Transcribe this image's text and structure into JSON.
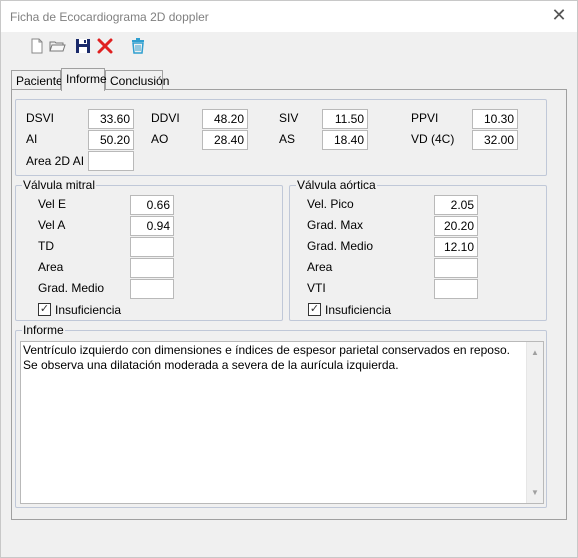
{
  "window": {
    "title": "Ficha de Ecocardiograma 2D doppler"
  },
  "toolbar": {
    "icons": [
      "new-document-icon",
      "open-folder-icon",
      "save-disk-icon",
      "delete-x-icon",
      "trash-icon"
    ]
  },
  "tabs": [
    {
      "label": "Paciente"
    },
    {
      "label": "Informe",
      "active": true
    },
    {
      "label": "Conclusión"
    }
  ],
  "measures": {
    "dsvi": {
      "label": "DSVI",
      "value": "33.60"
    },
    "ddvi": {
      "label": "DDVI",
      "value": "48.20"
    },
    "siv": {
      "label": "SIV",
      "value": "11.50"
    },
    "ppvi": {
      "label": "PPVI",
      "value": "10.30"
    },
    "ai": {
      "label": "AI",
      "value": "50.20"
    },
    "ao": {
      "label": "AO",
      "value": "28.40"
    },
    "as": {
      "label": "AS",
      "value": "18.40"
    },
    "vd4c": {
      "label": "VD (4C)",
      "value": "32.00"
    },
    "area2dai": {
      "label": "Area 2D AI",
      "value": ""
    }
  },
  "mitral": {
    "title": "Válvula mitral",
    "vel_e": {
      "label": "Vel E",
      "value": "0.66"
    },
    "vel_a": {
      "label": "Vel A",
      "value": "0.94"
    },
    "td": {
      "label": "TD",
      "value": ""
    },
    "area": {
      "label": "Area",
      "value": ""
    },
    "grad_medio": {
      "label": "Grad. Medio",
      "value": ""
    },
    "insuficiencia": {
      "label": "Insuficiencia",
      "checked": true
    }
  },
  "aortica": {
    "title": "Válvula aórtica",
    "vel_pico": {
      "label": "Vel. Pico",
      "value": "2.05"
    },
    "grad_max": {
      "label": "Grad. Max",
      "value": "20.20"
    },
    "grad_medio": {
      "label": "Grad. Medio",
      "value": "12.10"
    },
    "area": {
      "label": "Area",
      "value": ""
    },
    "vti": {
      "label": "VTI",
      "value": ""
    },
    "insuficiencia": {
      "label": "Insuficiencia",
      "checked": true
    }
  },
  "informe": {
    "title": "Informe",
    "text": "Ventrículo izquierdo con dimensiones e índices de espesor parietal conservados en reposo. Se observa una dilatación moderada a severa de la aurícula izquierda."
  },
  "colors": {
    "delete": "#e02020",
    "trash": "#2f9fd0",
    "save": "#1a2a6a"
  }
}
